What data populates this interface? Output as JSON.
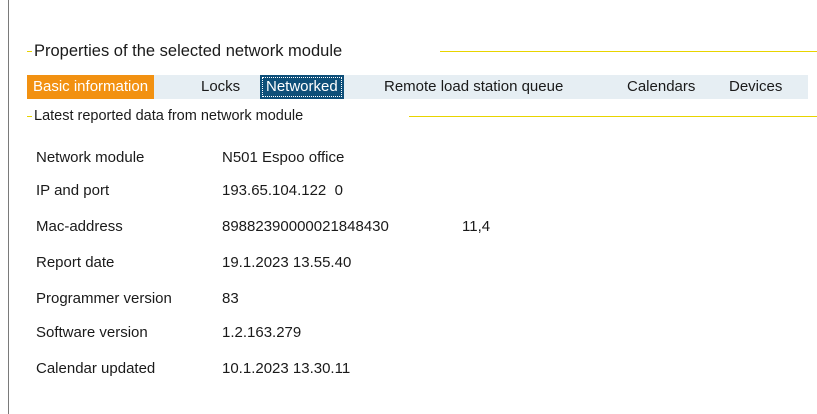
{
  "group": {
    "title": "Properties of the selected network module",
    "accent_color": "#e8d400"
  },
  "tabs": [
    {
      "label": "Basic information",
      "state": "active",
      "color": "#f29111"
    },
    {
      "label": "Locks",
      "state": "normal"
    },
    {
      "label": "Networked",
      "state": "focused",
      "color": "#0e4f79"
    },
    {
      "label": "Remote load station queue",
      "state": "normal"
    },
    {
      "label": "Calendars",
      "state": "normal"
    },
    {
      "label": "Devices",
      "state": "normal"
    }
  ],
  "section": {
    "title": "Latest reported data from network module"
  },
  "properties": [
    {
      "label": "Network module",
      "value": "N501 Espoo office"
    },
    {
      "label": "IP and port",
      "value": "193.65.104.122  0"
    },
    {
      "label": "Mac-address",
      "value": "89882390000021848430",
      "extra": "11,4"
    },
    {
      "label": "Report date",
      "value": "19.1.2023 13.55.40"
    },
    {
      "label": "Programmer version",
      "value": "83"
    },
    {
      "label": "Software version",
      "value": "1.2.163.279"
    },
    {
      "label": "Calendar updated",
      "value": "10.1.2023 13.30.11"
    }
  ]
}
